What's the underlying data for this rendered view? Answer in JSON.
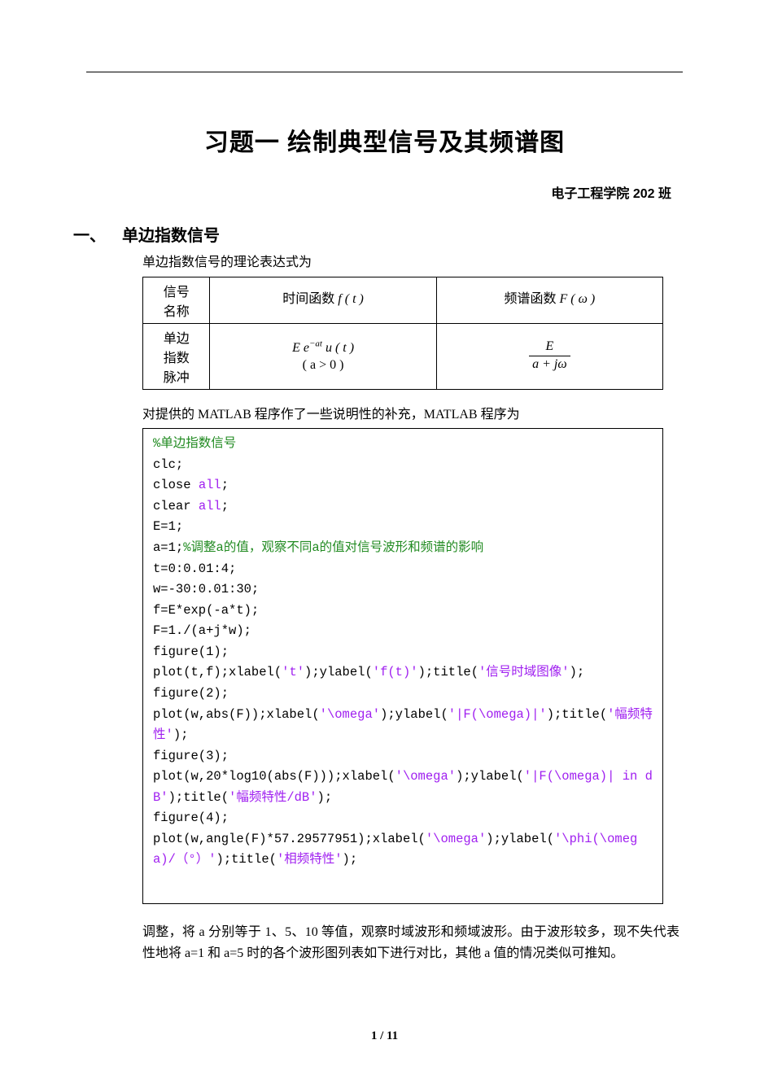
{
  "title": "习题一  绘制典型信号及其频谱图",
  "subtitle": "电子工程学院  202 班",
  "section": {
    "number": "一、",
    "heading": "单边指数信号",
    "p1": "单边指数信号的理论表达式为"
  },
  "table": {
    "h1": "信号名称",
    "h2": "时间函数 f ( t )",
    "h3": "频谱函数 F ( ω )",
    "row_name": "单边指数脉冲",
    "time_fn_1": "E e",
    "time_fn_sup": "−at",
    "time_fn_2": " u ( t )",
    "time_fn_cond": "( a > 0 )",
    "freq_num": "E",
    "freq_den": "a + jω"
  },
  "p2_pre": "对提供的 MATLAB 程序作了一些说明性的补充，MATLAB 程序为",
  "code": {
    "l01": "%单边指数信号",
    "l02": "clc;",
    "l03_a": "close ",
    "l03_b": "all",
    "l03_c": ";",
    "l04_a": "clear ",
    "l04_b": "all",
    "l04_c": ";",
    "l05": "E=1;",
    "l06_a": "a=1;",
    "l06_b": "%调整a的值，观察不同a的值对信号波形和频谱的影响",
    "l07": "t=0:0.01:4;",
    "l08": "w=-30:0.01:30;",
    "l09": "f=E*exp(-a*t);",
    "l10": "F=1./(a+j*w);",
    "l11": "figure(1);",
    "l12_a": "plot(t,f);xlabel(",
    "l12_b": "'t'",
    "l12_c": ");ylabel(",
    "l12_d": "'f(t)'",
    "l12_e": ");title(",
    "l12_f": "'信号时域图像'",
    "l12_g": ");",
    "l13": "figure(2);",
    "l14_a": "plot(w,abs(F));xlabel(",
    "l14_b": "'\\omega'",
    "l14_c": ");ylabel(",
    "l14_d": "'|F(\\omega)|'",
    "l14_e": ");title(",
    "l14_f": "'幅频特性'",
    "l14_g": ");",
    "l15": "figure(3);",
    "l16_a": "plot(w,20*log10(abs(F)));xlabel(",
    "l16_b": "'\\omega'",
    "l16_c": ");ylabel(",
    "l16_d": "'|F(\\omega)| in dB'",
    "l16_e": ");title(",
    "l16_f": "'幅频特性/dB'",
    "l16_g": ");",
    "l17": "figure(4);",
    "l18_a": "plot(w,angle(F)*57.29577951);xlabel(",
    "l18_b": "'\\omega'",
    "l18_c": ");ylabel(",
    "l18_d": "'\\phi(\\omega)/（°）'",
    "l18_e": ");title(",
    "l18_f": "'相频特性'",
    "l18_g": ");"
  },
  "p3": "调整，将 a 分别等于 1、5、10 等值，观察时域波形和频域波形。由于波形较多，现不失代表性地将 a=1 和 a=5 时的各个波形图列表如下进行对比，其他 a 值的情况类似可推知。",
  "footer": "1 / 11"
}
